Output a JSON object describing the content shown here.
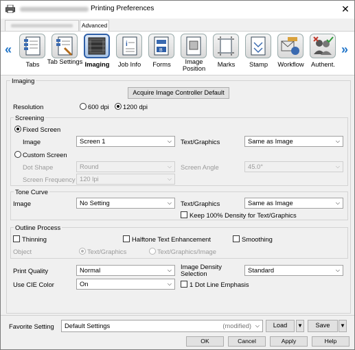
{
  "window": {
    "title": "Printing Preferences",
    "close": "✕"
  },
  "tabs": {
    "advanced": "Advanced"
  },
  "nav": {
    "prev": "«",
    "next": "»",
    "items": [
      {
        "label": "Tabs",
        "icon": "tabs-icon"
      },
      {
        "label": "Tab Settings",
        "icon": "tab-settings-icon"
      },
      {
        "label": "Imaging",
        "icon": "imaging-icon"
      },
      {
        "label": "Job Info",
        "icon": "job-info-icon"
      },
      {
        "label": "Forms",
        "icon": "forms-icon"
      },
      {
        "label": "Image Position",
        "icon": "image-position-icon"
      },
      {
        "label": "Marks",
        "icon": "marks-icon"
      },
      {
        "label": "Stamp",
        "icon": "stamp-icon"
      },
      {
        "label": "Workflow",
        "icon": "workflow-icon"
      },
      {
        "label": "Authent.",
        "icon": "authentication-icon"
      }
    ]
  },
  "imaging": {
    "group_title": "Imaging",
    "acquire_button": "Acquire Image Controller Default",
    "resolution_label": "Resolution",
    "res_600": "600 dpi",
    "res_1200": "1200 dpi",
    "screening": {
      "title": "Screening",
      "fixed": "Fixed Screen",
      "image_label": "Image",
      "image_value": "Screen 1",
      "text_graphics_label": "Text/Graphics",
      "text_graphics_value": "Same as Image",
      "custom": "Custom Screen",
      "dot_shape_label": "Dot Shape",
      "dot_shape_value": "Round",
      "screen_angle_label": "Screen Angle",
      "screen_angle_value": "45.0°",
      "screen_freq_label": "Screen Frequency",
      "screen_freq_value": "120 lpi"
    },
    "tone": {
      "title": "Tone Curve",
      "image_label": "Image",
      "image_value": "No Setting",
      "text_graphics_label": "Text/Graphics",
      "text_graphics_value": "Same as Image",
      "keep_density": "Keep 100% Density for Text/Graphics"
    },
    "outline": {
      "title": "Outline Process",
      "thinning": "Thinning",
      "halftone": "Halftone Text Enhancement",
      "smoothing": "Smoothing",
      "object_label": "Object",
      "obj_tg": "Text/Graphics",
      "obj_tgi": "Text/Graphics/Image"
    },
    "print_quality_label": "Print Quality",
    "print_quality_value": "Normal",
    "density_label": "Image Density Selection",
    "density_value": "Standard",
    "cie_label": "Use CIE Color",
    "cie_value": "On",
    "dot_line": "1 Dot Line Emphasis"
  },
  "favorite": {
    "label": "Favorite Setting",
    "value": "Default Settings",
    "modified": "(modified)",
    "load": "Load",
    "save": "Save"
  },
  "buttons": {
    "ok": "OK",
    "cancel": "Cancel",
    "apply": "Apply",
    "help": "Help"
  }
}
